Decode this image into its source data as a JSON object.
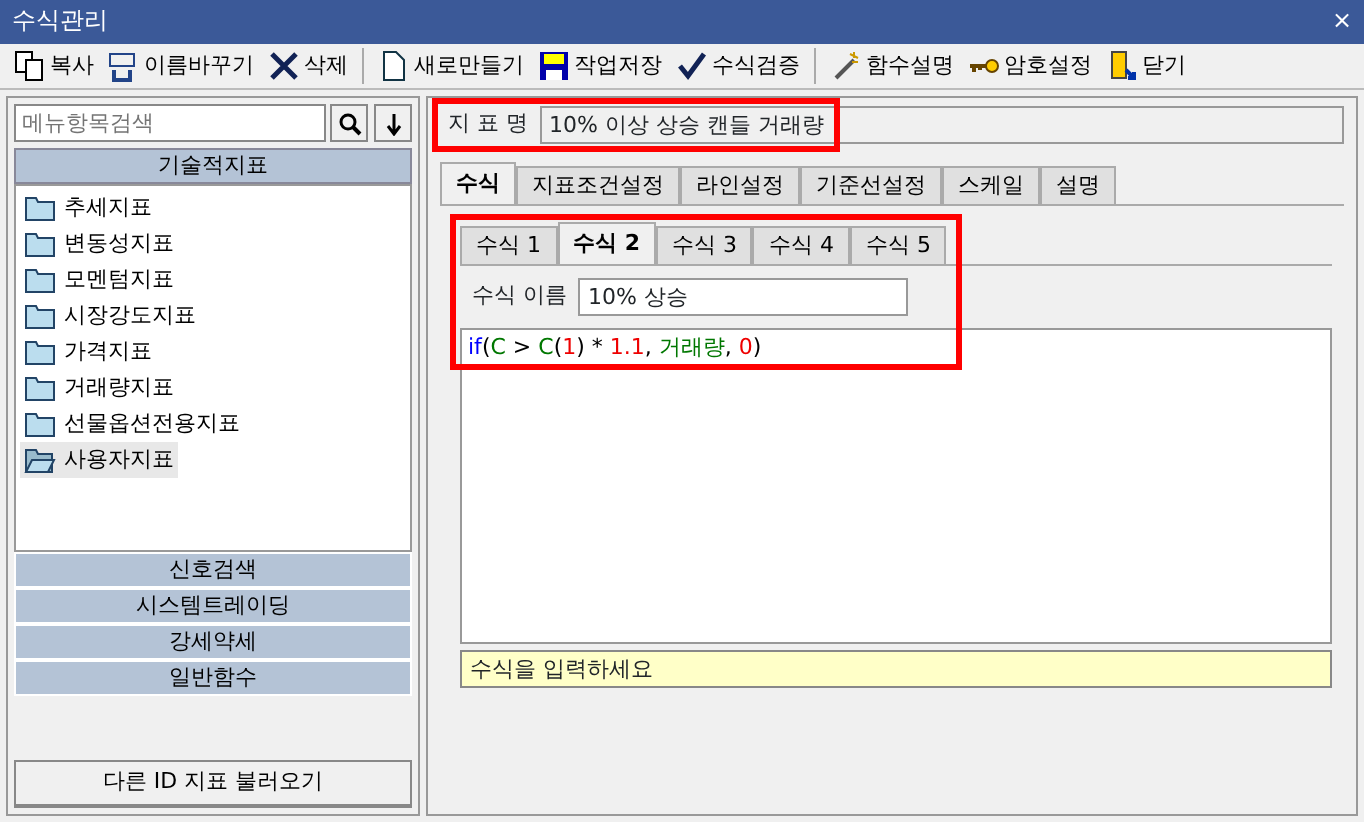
{
  "window": {
    "title": "수식관리",
    "close": "×"
  },
  "toolbar": [
    {
      "label": "복사",
      "separator_before": false
    },
    {
      "label": "이름바꾸기",
      "separator_before": false
    },
    {
      "label": "삭제",
      "separator_before": false
    },
    {
      "label": "새로만들기",
      "separator_before": true
    },
    {
      "label": "작업저장",
      "separator_before": false
    },
    {
      "label": "수식검증",
      "separator_before": false
    },
    {
      "label": "함수설명",
      "separator_before": true
    },
    {
      "label": "암호설정",
      "separator_before": false
    },
    {
      "label": "닫기",
      "separator_before": false
    }
  ],
  "sidebar": {
    "search": {
      "placeholder": "메뉴항목검색"
    },
    "groups": [
      {
        "label": "기술적지표",
        "expanded": true,
        "items": [
          {
            "label": "추세지표",
            "selected": false
          },
          {
            "label": "변동성지표",
            "selected": false
          },
          {
            "label": "모멘텀지표",
            "selected": false
          },
          {
            "label": "시장강도지표",
            "selected": false
          },
          {
            "label": "가격지표",
            "selected": false
          },
          {
            "label": "거래량지표",
            "selected": false
          },
          {
            "label": "선물옵션전용지표",
            "selected": false
          },
          {
            "label": "사용자지표",
            "selected": true
          }
        ]
      },
      {
        "label": "신호검색",
        "expanded": false
      },
      {
        "label": "시스템트레이딩",
        "expanded": false
      },
      {
        "label": "강세약세",
        "expanded": false
      },
      {
        "label": "일반함수",
        "expanded": false
      }
    ],
    "load_button": "다른 ID 지표 불러오기"
  },
  "indicator": {
    "label": "지 표 명",
    "value": "10% 이상 상승 캔들 거래량",
    "highlighted": true
  },
  "tabs": [
    {
      "label": "수식",
      "selected": true
    },
    {
      "label": "지표조건설정",
      "selected": false
    },
    {
      "label": "라인설정",
      "selected": false
    },
    {
      "label": "기준선설정",
      "selected": false
    },
    {
      "label": "스케일",
      "selected": false
    },
    {
      "label": "설명",
      "selected": false
    }
  ],
  "formula_tabs": [
    {
      "label": "수식 1",
      "selected": false
    },
    {
      "label": "수식 2",
      "selected": true
    },
    {
      "label": "수식 3",
      "selected": false
    },
    {
      "label": "수식 4",
      "selected": false
    },
    {
      "label": "수식 5",
      "selected": false
    }
  ],
  "formula_name": {
    "label": "수식 이름",
    "value": "10% 상승"
  },
  "formula_highlighted": true,
  "formula": [
    {
      "text": "if",
      "kind": "keyword"
    },
    {
      "text": "(",
      "kind": "plain"
    },
    {
      "text": "C",
      "kind": "variable"
    },
    {
      "text": " > ",
      "kind": "plain"
    },
    {
      "text": "C",
      "kind": "variable"
    },
    {
      "text": "(",
      "kind": "plain"
    },
    {
      "text": "1",
      "kind": "number"
    },
    {
      "text": ") * ",
      "kind": "plain"
    },
    {
      "text": "1.1",
      "kind": "number"
    },
    {
      "text": ", ",
      "kind": "plain"
    },
    {
      "text": "거래량",
      "kind": "variable"
    },
    {
      "text": ", ",
      "kind": "plain"
    },
    {
      "text": "0",
      "kind": "number"
    },
    {
      "text": ")",
      "kind": "plain"
    }
  ],
  "hint": "수식을 입력하세요"
}
